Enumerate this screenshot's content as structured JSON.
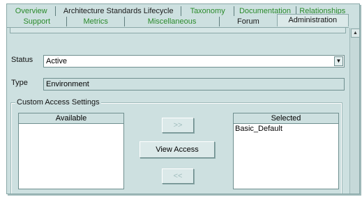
{
  "tabs": {
    "row1": [
      {
        "label": "Overview",
        "color": "green"
      },
      {
        "label": "Architecture Standards Lifecycle",
        "color": "black"
      },
      {
        "label": "Taxonomy",
        "color": "green"
      },
      {
        "label": "Documentation",
        "color": "green"
      },
      {
        "label": "Relationships",
        "color": "green"
      }
    ],
    "row2": [
      {
        "label": "Support",
        "color": "green"
      },
      {
        "label": "Metrics",
        "color": "green"
      },
      {
        "label": "Miscellaneous",
        "color": "green"
      },
      {
        "label": "Forum",
        "color": "black"
      },
      {
        "label": "Administration",
        "color": "black",
        "active": true
      }
    ]
  },
  "form": {
    "status_label": "Status",
    "status_value": "Active",
    "type_label": "Type",
    "type_value": "Environment"
  },
  "access": {
    "group_title": "Custom Access Settings",
    "available_header": "Available",
    "selected_header": "Selected",
    "available_items": [],
    "selected_items": [
      "Basic_Default"
    ],
    "add_button": ">>",
    "view_button": "View Access",
    "remove_button": "<<"
  },
  "icons": {
    "dropdown": "chevron-down-icon",
    "scroll_up": "scroll-up-arrow-icon"
  },
  "colors": {
    "panel_bg": "#cde0e0",
    "tab_green": "#2a8a2a",
    "disabled_text": "#9fbcbc"
  }
}
